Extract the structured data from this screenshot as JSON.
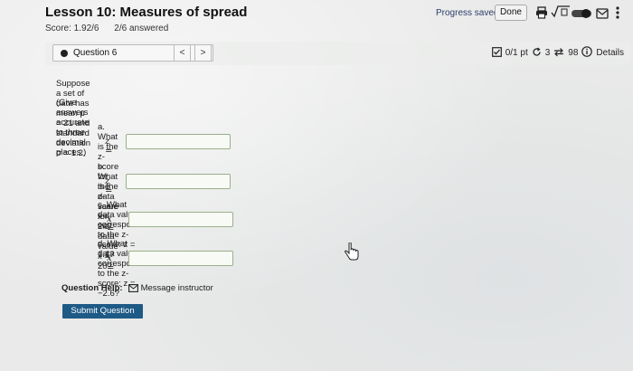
{
  "header": {
    "title": "Lesson 10: Measures of spread",
    "score": "Score: 1.92/6",
    "answered": "2/6 answered",
    "progress_status": "Progress saved",
    "done_label": "Done"
  },
  "question_bar": {
    "selected_question": "Question 6",
    "prev_symbol": "<",
    "next_symbol": ">",
    "points": "0/1 pt",
    "retries": "3",
    "attempts": "98",
    "details_label": "Details"
  },
  "question": {
    "prompt": "Suppose a set of data has mean μ = 21 and standard deviation σ = 1.2.",
    "instruction": "(Give answers accurate to three decimal places.)",
    "parts": [
      {
        "text": "a. What is the z-score for the data value x = 24?",
        "answer_var": "z =",
        "answer_value": ""
      },
      {
        "text": "b. What is the z-score for the data value x = 20?",
        "answer_var": "z =",
        "answer_value": ""
      },
      {
        "text": "c. What data value corresponds to the z-score: z = 1.1?",
        "answer_var": "x =",
        "answer_value": ""
      },
      {
        "text": "d. What data value corresponds to the z-score: z = −2.6?",
        "answer_var": "x =",
        "answer_value": ""
      }
    ]
  },
  "help": {
    "label": "Question Help:",
    "message_link": "Message instructor"
  },
  "submit_label": "Submit Question",
  "colors": {
    "submit_bg": "#1e5a86",
    "answer_border": "#9ab08a",
    "progress_text": "#2b3d6b"
  },
  "icons": [
    "print-icon",
    "sqrt-icon",
    "toggle-icon",
    "mail-icon",
    "more-icon",
    "checkbox-icon",
    "retry-icon",
    "attempts-icon",
    "info-icon",
    "mouse-cursor-icon"
  ]
}
